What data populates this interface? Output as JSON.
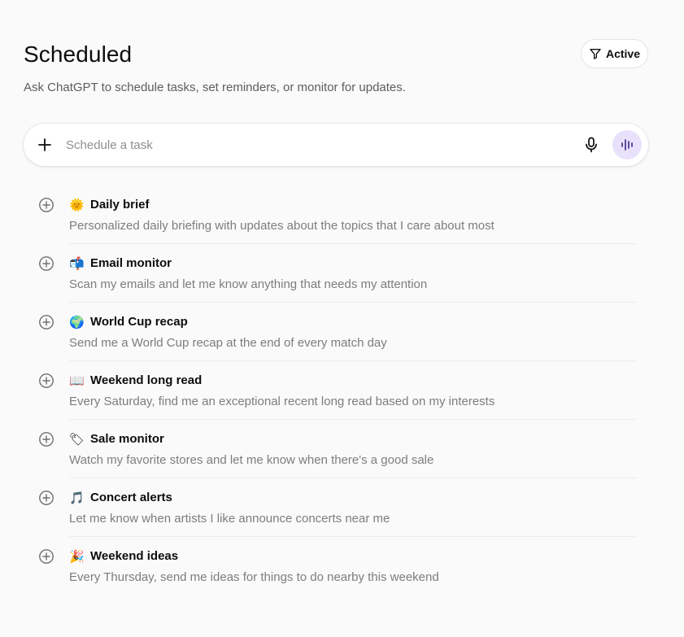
{
  "header": {
    "title": "Scheduled",
    "filter_label": "Active",
    "filter_icon": "filter-icon",
    "subtitle": "Ask ChatGPT to schedule tasks, set reminders, or monitor for updates."
  },
  "composer": {
    "placeholder": "Schedule a task",
    "value": "",
    "add_icon": "plus-icon",
    "mic_icon": "microphone-icon",
    "voice_icon": "voice-waveform-icon",
    "voice_button_color": "#e8e1fb"
  },
  "tasks": [
    {
      "emoji": "🌞",
      "icon": "sun-emoji-icon",
      "title": "Daily brief",
      "description": "Personalized daily briefing with updates about the topics that I care about most"
    },
    {
      "emoji": "📬",
      "icon": "mailbox-emoji-icon",
      "title": "Email monitor",
      "description": "Scan my emails and let me know anything that needs my attention"
    },
    {
      "emoji": "🌍",
      "icon": "globe-emoji-icon",
      "title": "World Cup recap",
      "description": "Send me a World Cup recap at the end of every match day"
    },
    {
      "emoji": "📖",
      "icon": "open-book-emoji-icon",
      "title": "Weekend long read",
      "description": "Every Saturday, find me an exceptional recent long read based on my interests"
    },
    {
      "emoji": "🏷",
      "icon": "tag-emoji-icon",
      "title": "Sale monitor",
      "description": "Watch my favorite stores and let me know when there's a good sale"
    },
    {
      "emoji": "🎵",
      "icon": "music-note-emoji-icon",
      "title": "Concert alerts",
      "description": "Let me know when artists I like announce concerts near me"
    },
    {
      "emoji": "🎉",
      "icon": "party-popper-emoji-icon",
      "title": "Weekend ideas",
      "description": "Every Thursday, send me ideas for things to do nearby this weekend"
    }
  ],
  "colors": {
    "background": "#fafafa",
    "text_primary": "#0d0d0d",
    "text_secondary": "#7d7d7d"
  }
}
